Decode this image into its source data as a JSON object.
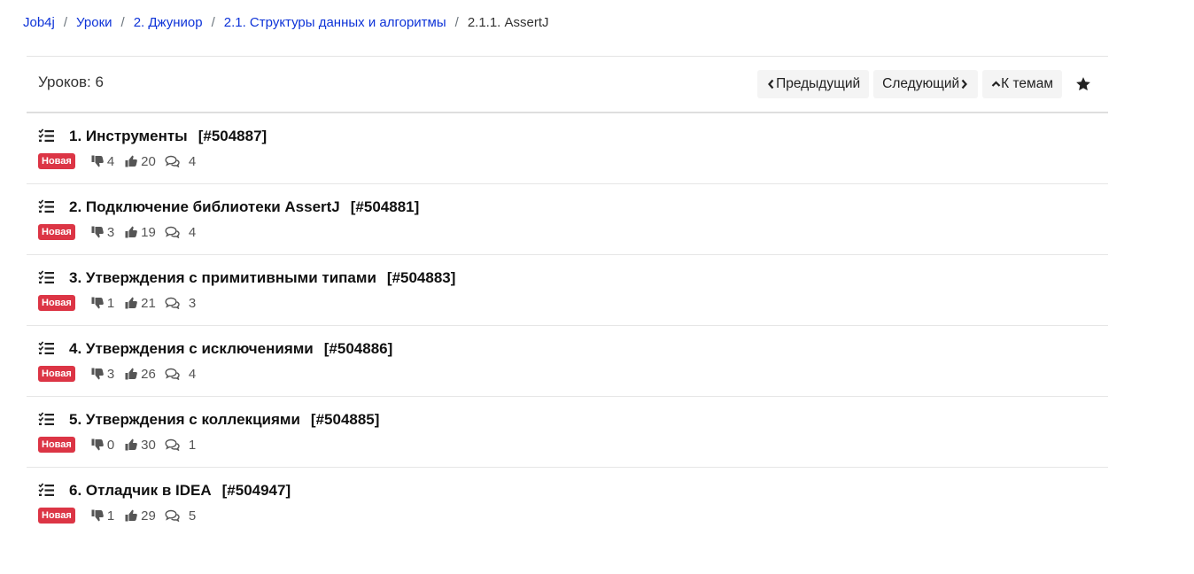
{
  "breadcrumb": [
    {
      "label": "Job4j"
    },
    {
      "label": "Уроки"
    },
    {
      "label": "2. Джуниор"
    },
    {
      "label": "2.1. Структуры данных и алгоритмы"
    }
  ],
  "breadcrumb_current": "2.1.1. AssertJ",
  "header": {
    "lesson_count": "Уроков: 6",
    "prev_label": "Предыдущий",
    "next_label": "Следующий",
    "topics_label": "К темам"
  },
  "lessons": [
    {
      "title": "1. Инструменты",
      "task_id": "[#504887]",
      "badge": "Новая",
      "dislikes": "4",
      "likes": "20",
      "comments": "4"
    },
    {
      "title": "2. Подключение библиотеки AssertJ",
      "task_id": "[#504881]",
      "badge": "Новая",
      "dislikes": "3",
      "likes": "19",
      "comments": "4"
    },
    {
      "title": "3. Утверждения с примитивными типами",
      "task_id": "[#504883]",
      "badge": "Новая",
      "dislikes": "1",
      "likes": "21",
      "comments": "3"
    },
    {
      "title": "4. Утверждения с исключениями",
      "task_id": "[#504886]",
      "badge": "Новая",
      "dislikes": "3",
      "likes": "26",
      "comments": "4"
    },
    {
      "title": "5. Утверждения с коллекциями",
      "task_id": "[#504885]",
      "badge": "Новая",
      "dislikes": "0",
      "likes": "30",
      "comments": "1"
    },
    {
      "title": "6. Отладчик в IDEA",
      "task_id": "[#504947]",
      "badge": "Новая",
      "dislikes": "1",
      "likes": "29",
      "comments": "5"
    }
  ],
  "colors": {
    "link": "#0d33d8",
    "badge": "#dc3545"
  },
  "icons": {
    "task": "tasks-icon",
    "dislike": "thumbs-down-icon",
    "like": "thumbs-up-icon",
    "comment": "comments-icon",
    "star": "star-icon"
  }
}
